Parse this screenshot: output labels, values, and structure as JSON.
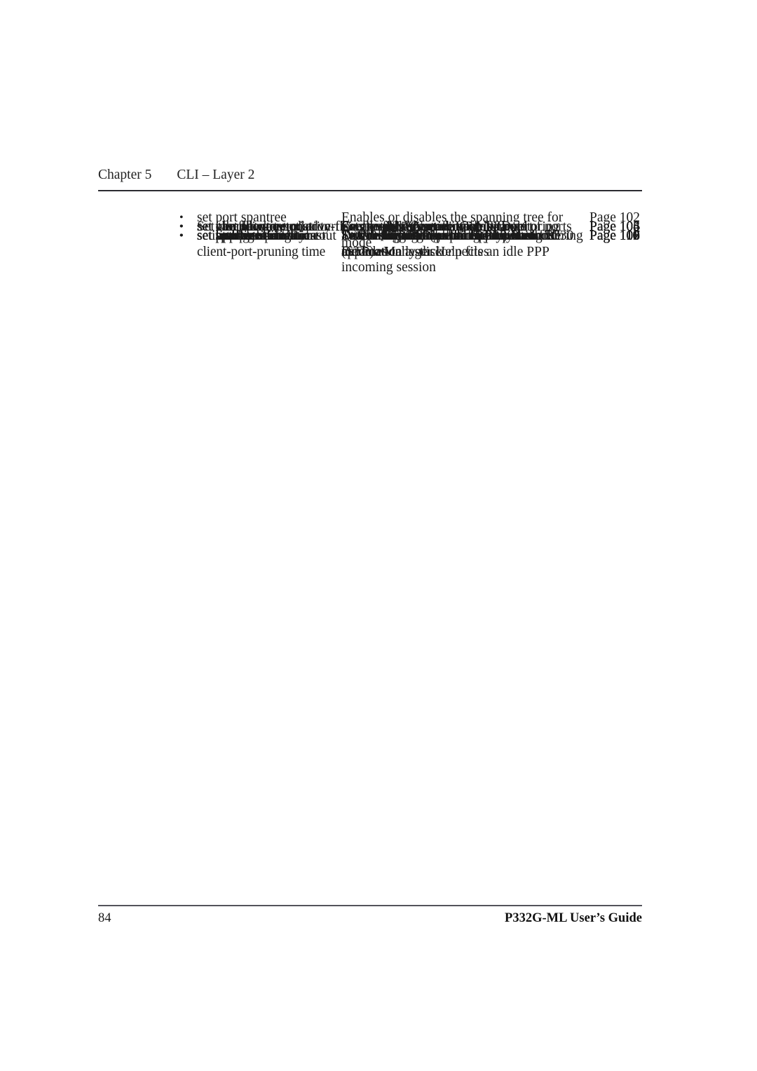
{
  "header": {
    "chapter_number": "Chapter 5",
    "chapter_title": "CLI – Layer 2"
  },
  "footer": {
    "page_number": "84",
    "guide_title": "P332G-ML User’s Guide"
  },
  "bullet_glyph": "•",
  "table": {
    "rows": [
      {
        "command": "set port spantree",
        "description": "Enables or disables the spanning tree for switch ports",
        "page": "Page 102",
        "wide": false
      },
      {
        "command": "set port spantree priority",
        "description": "Set the port spantree priority level",
        "page": "Page 103",
        "wide": false
      },
      {
        "command": "set port spantree cost",
        "description": "Set the port spantree cost",
        "page": "Page 103",
        "wide": false
      },
      {
        "command": "set port security",
        "description": "Enables MAC security on a range of ports",
        "page": "Page 104",
        "wide": false
      },
      {
        "command": "set cascading",
        "description": "Sets module cascading fault-monitoring mode",
        "page": "Page 104",
        "wide": false
      },
      {
        "command": "set inband vlan",
        "description": "Set the management VLAN ID",
        "page": "Page 104",
        "wide": false
      },
      {
        "command": "set vlan",
        "description": "Creates VLANs",
        "page": "Page 105",
        "wide": false
      },
      {
        "command": "set port flowcontrol",
        "description": "Set the flow control mode of a port",
        "page": "Page 105",
        "wide": false
      },
      {
        "command": "set port auto-negotiation-flowcontrol-advertisement",
        "description": "Set the flowcontrol advertising capabilities of a Gigabit port",
        "page": "Page 106",
        "wide": true
      },
      {
        "command": "set trunk",
        "description": "Set the tagging mode of a port",
        "page": "Page 106",
        "wide": false
      },
      {
        "command": "set spantree",
        "description": "Enable/Disable Spanning Tree Protocol (STP)",
        "page": "Page 107",
        "wide": false
      },
      {
        "command": "set spantree priority",
        "description": "Set the STP Bridge priority level",
        "page": "Page 107",
        "wide": false
      },
      {
        "command": "set autopartition",
        "description": "To enable or disable autopartitioning for modules in a stack",
        "page": "Page 107",
        "wide": false
      },
      {
        "command": "set license",
        "description": "Enter a license number for the stack",
        "page": "Page 109",
        "wide": false
      },
      {
        "command": "set ppp authentication",
        "description": "Defines the PPP authentication method",
        "page": "Page 109",
        "wide": false
      },
      {
        "command": "set ppp incoming timeout",
        "description": "Sets the time after which the system automatically disconnects an idle PPP incoming session",
        "page": "Page 110",
        "wide": false
      },
      {
        "command": "set ppp baud-rate",
        "description": "Sets the baud rate used in PPP sessions",
        "page": "Page 110",
        "wide": false
      },
      {
        "command": "set web aux-files-url",
        "description": "Set the location (url/directory) of the P330 Device Manager Help files",
        "page": "Page 110",
        "wide": false
      },
      {
        "command": "set intelligent-multicast",
        "description": "Enables or disables the IP multicast filtering application",
        "page": "Page 111",
        "wide": false
      },
      {
        "command": "setintelligent-multicast client-port-pruning time",
        "description": "Sets the aging time for client ports",
        "page": "Page 111",
        "wide": false,
        "tight": true
      }
    ]
  }
}
